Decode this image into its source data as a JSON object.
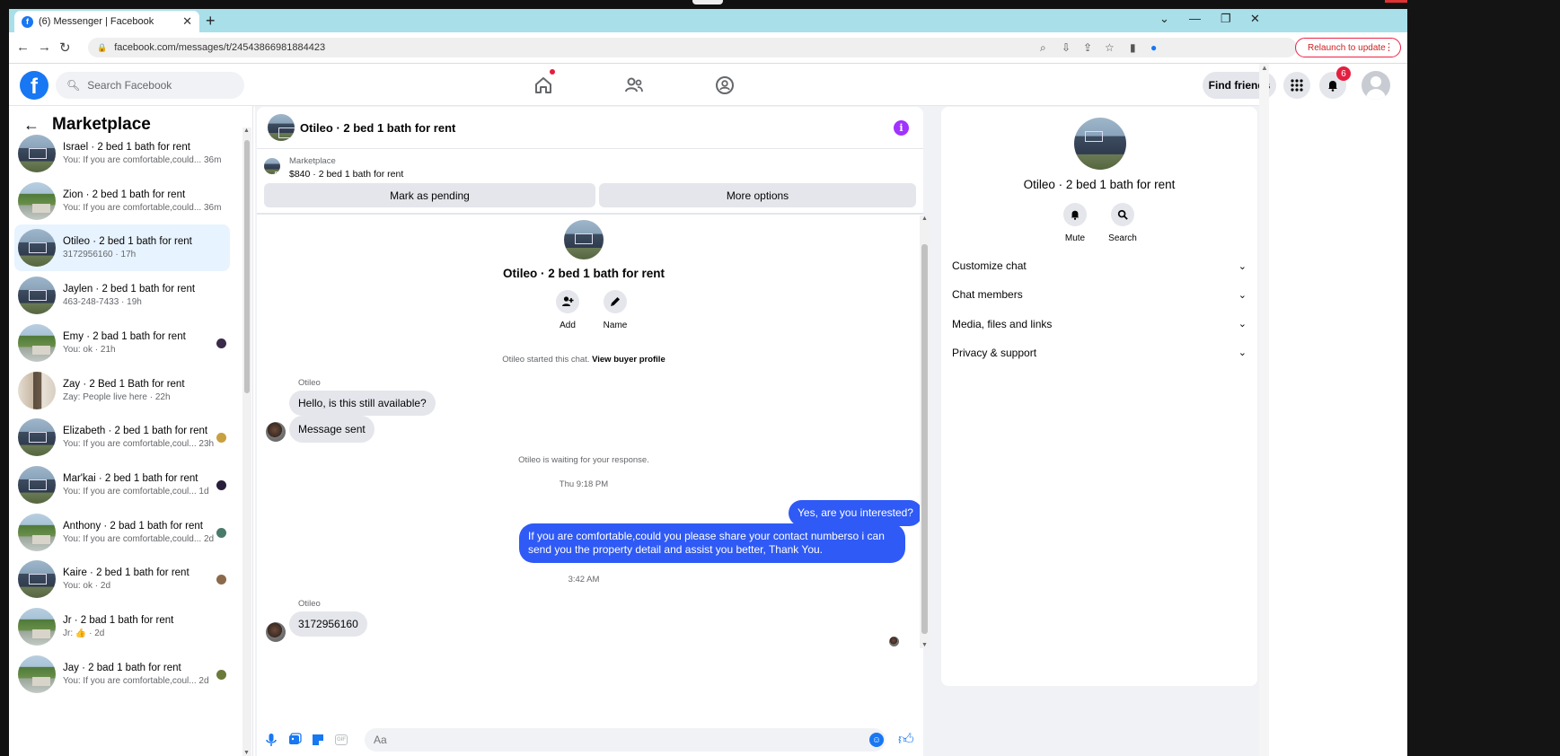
{
  "browser": {
    "tab_title": "(6) Messenger | Facebook",
    "tab_favicon": "f",
    "new_tab": "+",
    "url": "facebook.com/messages/t/24543866981884423",
    "relaunch_label": "Relaunch to update"
  },
  "header": {
    "logo": "f",
    "search_placeholder": "Search Facebook",
    "find_friends": "Find friends",
    "notification_count": "6"
  },
  "sidebar": {
    "title": "Marketplace",
    "conversations": [
      {
        "name": "Israel · 2 bed 1 bath for rent",
        "preview": "You: If you are comfortable,could...",
        "time": "36m",
        "thumb": "house"
      },
      {
        "name": "Zion · 2 bed 1 bath for rent",
        "preview": "You: If you are comfortable,could...",
        "time": "36m",
        "thumb": "tree"
      },
      {
        "name": "Otileo · 2 bed 1 bath for rent",
        "preview": "3172956160 · 17h",
        "time": "",
        "thumb": "house",
        "active": true
      },
      {
        "name": "Jaylen · 2 bed 1 bath for rent",
        "preview": "463-248-7433 · 19h",
        "time": "",
        "thumb": "house"
      },
      {
        "name": "Emy · 2 bad 1 bath for rent",
        "preview": "You: ok · 21h",
        "time": "",
        "thumb": "tree",
        "mini": "#3b2a4a"
      },
      {
        "name": "Zay · 2 Bed 1 Bath for rent",
        "preview": "Zay: People live here · 22h",
        "time": "",
        "thumb": "room"
      },
      {
        "name": "Elizabeth · 2 bed 1 bath for rent",
        "preview": "You: If you are comfortable,coul...",
        "time": "23h",
        "thumb": "house",
        "mini": "#c8a040"
      },
      {
        "name": "Mar'kai · 2 bed 1 bath for rent",
        "preview": "You: If you are comfortable,coul...",
        "time": "1d",
        "thumb": "house",
        "mini": "#2a1f3a"
      },
      {
        "name": "Anthony · 2 bad 1 bath for rent",
        "preview": "You: If you are comfortable,could...",
        "time": "2d",
        "thumb": "tree",
        "mini": "#4a7a6a"
      },
      {
        "name": "Kaire · 2 bed 1 bath for rent",
        "preview": "You: ok · 2d",
        "time": "",
        "thumb": "house",
        "mini": "#8a6a4a"
      },
      {
        "name": "Jr · 2 bad 1 bath for rent",
        "preview": "Jr: 👍 · 2d",
        "time": "",
        "thumb": "tree"
      },
      {
        "name": "Jay · 2 bad 1 bath for rent",
        "preview": "You: If you are comfortable,coul...",
        "time": "2d",
        "thumb": "tree",
        "mini": "#6a7a3a"
      }
    ]
  },
  "chat": {
    "title": "Otileo · 2 bed 1 bath for rent",
    "marketplace_label": "Marketplace",
    "listing": "$840 · 2 bed 1 bath for rent",
    "mark_pending": "Mark as pending",
    "more_options": "More options",
    "center_name": "Otileo · 2 bed 1 bath for rent",
    "add_label": "Add",
    "name_label": "Name",
    "started_text": "Otileo started this chat.",
    "view_profile": "View buyer profile",
    "sender1": "Otileo",
    "msg1": "Hello, is this still available?",
    "msg2": "Message sent",
    "waiting": "Otileo is waiting for your response.",
    "time1": "Thu 9:18 PM",
    "out1": "Yes, are you interested?",
    "out2": "If you are comfortable,could you please share your contact numberso i can send you the property detail and assist you better, Thank You.",
    "time2": "3:42 AM",
    "sender2": "Otileo",
    "msg3": "3172956160",
    "composer_placeholder": "Aa"
  },
  "details": {
    "name": "Otileo · 2 bed 1 bath for rent",
    "mute": "Mute",
    "search": "Search",
    "sections": [
      "Customize chat",
      "Chat members",
      "Media, files and links",
      "Privacy & support"
    ]
  },
  "colors": {
    "brand": "#1877f2",
    "outgoing_bubble": "#2f5af5",
    "info": "#a033ff",
    "badge": "#e41e3f"
  }
}
